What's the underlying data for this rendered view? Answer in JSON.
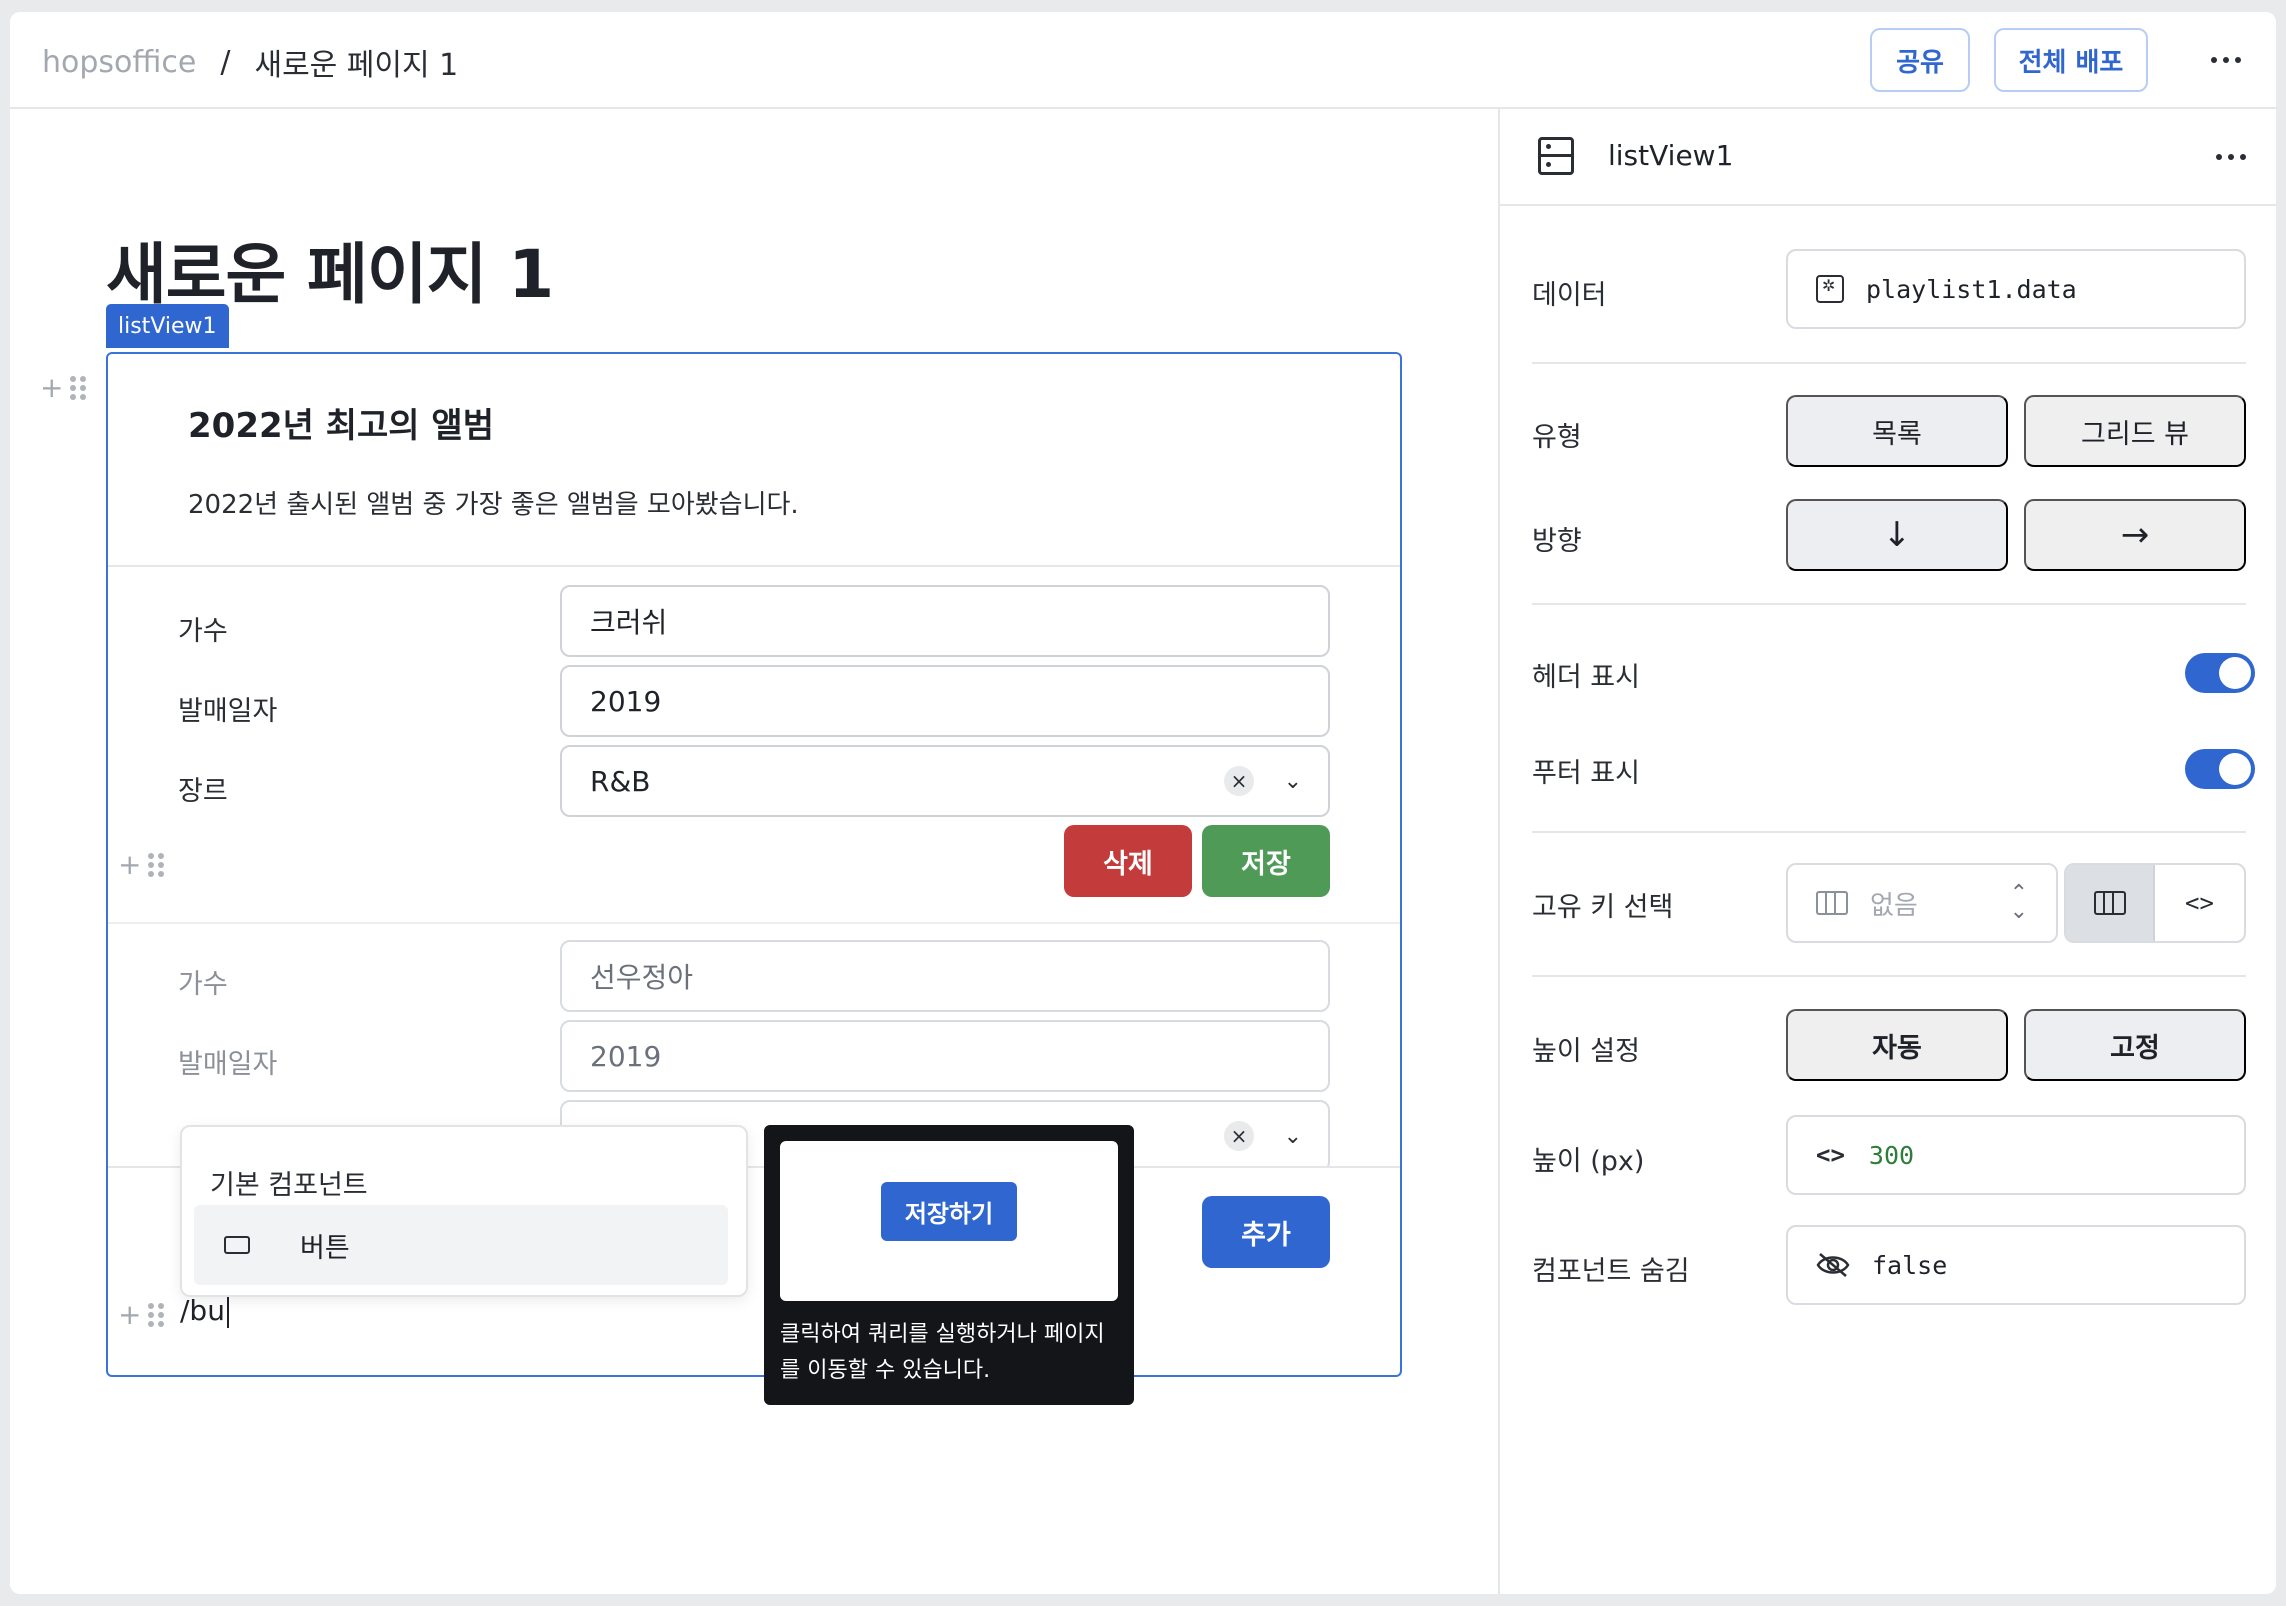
{
  "topbar": {
    "workspace": "hopsoffice",
    "separator": "/",
    "page": "새로운 페이지 1",
    "share_label": "공유",
    "deploy_label": "전체 배포",
    "more_icon": "more-horizontal-icon"
  },
  "canvas": {
    "page_title": "새로운 페이지 1",
    "component_tag": "listView1",
    "list_header": {
      "title": "2022년 최고의 앨범",
      "description": "2022년 출시된 앨범 중 가장 좋은 앨범을 모아봤습니다."
    },
    "items": [
      {
        "singer_label": "가수",
        "singer_value": "크러쉬",
        "date_label": "발매일자",
        "date_value": "2019",
        "genre_label": "장르",
        "genre_value": "R&B",
        "delete_label": "삭제",
        "save_label": "저장"
      },
      {
        "singer_label": "가수",
        "singer_value": "선우정아",
        "date_label": "발매일자",
        "date_value": "2019"
      }
    ],
    "footer": {
      "add_label": "추가",
      "slash_input": "/bu"
    }
  },
  "menu": {
    "heading": "기본 컴포넌트",
    "item_label": "버튼",
    "item_icon": "button-shape-icon"
  },
  "tooltip": {
    "preview_button": "저장하기",
    "text": "클릭하여 쿼리를 실행하거나 페이지를 이동할 수 있습니다."
  },
  "panel": {
    "title": "listView1",
    "icon": "list-view-icon",
    "data_label": "데이터",
    "data_value": "playlist1.data",
    "type_label": "유형",
    "type_options": [
      "목록",
      "그리드 뷰"
    ],
    "type_selected": "목록",
    "direction_label": "방향",
    "direction_options": [
      "↓",
      "→"
    ],
    "header_label": "헤더 표시",
    "header_on": true,
    "footer_label": "푸터 표시",
    "footer_on": true,
    "key_label": "고유 키 선택",
    "key_value": "없음",
    "height_mode_label": "높이 설정",
    "height_options": [
      "자동",
      "고정"
    ],
    "height_selected": "고정",
    "height_px_label": "높이 (px)",
    "height_px_value": "300",
    "hidden_label": "컴포넌트 숨김",
    "hidden_value": "false"
  },
  "colors": {
    "accent": "#2f66d0",
    "danger": "#c33b3b",
    "success": "#4f9a57"
  }
}
